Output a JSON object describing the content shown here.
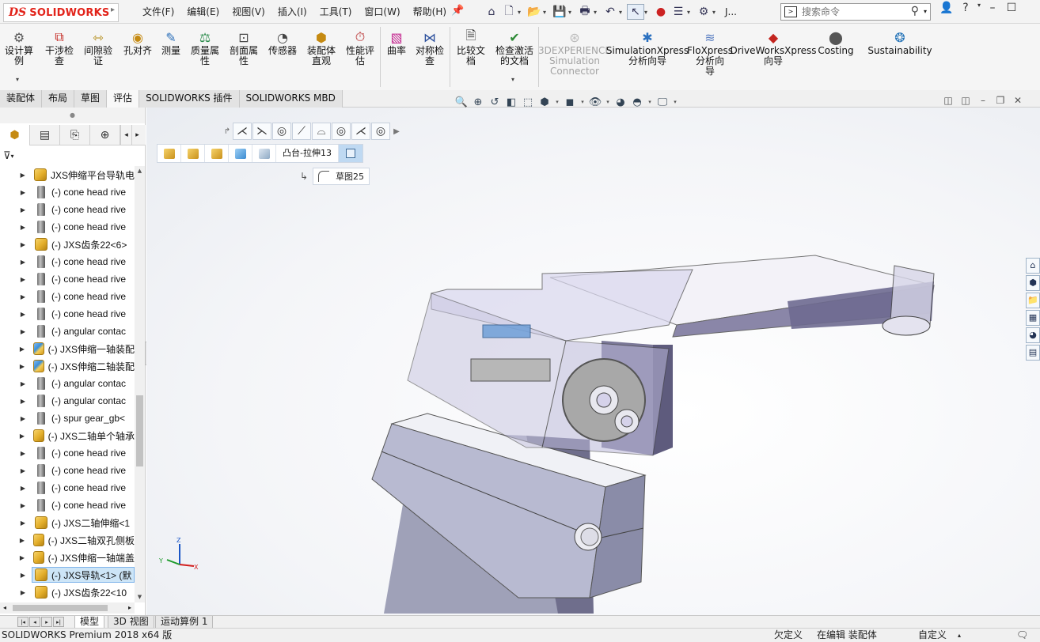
{
  "app": {
    "logo_ds": "DS",
    "logo_name": "SOLIDWORKS"
  },
  "menu": [
    "文件(F)",
    "编辑(E)",
    "视图(V)",
    "插入(I)",
    "工具(T)",
    "窗口(W)",
    "帮助(H)"
  ],
  "quick_access": {
    "user_label": "J..."
  },
  "search": {
    "placeholder": "搜索命令"
  },
  "ribbon": {
    "items": [
      {
        "label": "设计算\n例",
        "icon": "design-study-icon"
      },
      {
        "label": "干涉检\n查",
        "icon": "interference-check-icon"
      },
      {
        "label": "间隙验\n证",
        "icon": "clearance-verification-icon"
      },
      {
        "label": "孔对齐",
        "icon": "hole-alignment-icon"
      },
      {
        "label": "测量",
        "icon": "measure-icon"
      },
      {
        "label": "质量属\n性",
        "icon": "mass-properties-icon"
      },
      {
        "label": "剖面属\n性",
        "icon": "section-properties-icon"
      },
      {
        "label": "传感器",
        "icon": "sensor-icon"
      },
      {
        "label": "装配体\n直观",
        "icon": "assembly-visualization-icon"
      },
      {
        "label": "性能评\n估",
        "icon": "performance-evaluation-icon"
      },
      {
        "label": "曲率",
        "icon": "curvature-icon"
      },
      {
        "label": "对称检\n查",
        "icon": "symmetry-check-icon"
      },
      {
        "label": "比较文\n档",
        "icon": "compare-documents-icon"
      },
      {
        "label": "检查激活\n的文档",
        "icon": "check-active-document-icon"
      },
      {
        "label": "3DEXPERIENCE\nSimulation\nConnector",
        "icon": "3dexperience-icon",
        "disabled": true
      },
      {
        "label": "SimulationXpress\n分析向导",
        "icon": "simulationxpress-icon"
      },
      {
        "label": "FloXpress\n分析向\n导",
        "icon": "floxpress-icon"
      },
      {
        "label": "DriveWorksXpress\n向导",
        "icon": "driveworksxpress-icon"
      },
      {
        "label": "Costing",
        "icon": "costing-icon"
      },
      {
        "label": "Sustainability",
        "icon": "sustainability-icon"
      }
    ]
  },
  "tabs": [
    {
      "label": "装配体",
      "active": false
    },
    {
      "label": "布局",
      "active": false
    },
    {
      "label": "草图",
      "active": false
    },
    {
      "label": "评估",
      "active": true
    },
    {
      "label": "SOLIDWORKS 插件",
      "active": false
    },
    {
      "label": "SOLIDWORKS MBD",
      "active": false
    }
  ],
  "tree": {
    "rows": [
      {
        "text": "JXS伸缩平台导轨电",
        "icon": "assembly"
      },
      {
        "text": "(-) cone head rive",
        "icon": "part"
      },
      {
        "text": "(-) cone head rive",
        "icon": "part"
      },
      {
        "text": "(-) cone head rive",
        "icon": "part"
      },
      {
        "text": "(-) JXS齿条22<6>",
        "icon": "assembly"
      },
      {
        "text": "(-) cone head rive",
        "icon": "part"
      },
      {
        "text": "(-) cone head rive",
        "icon": "part"
      },
      {
        "text": "(-) cone head rive",
        "icon": "part"
      },
      {
        "text": "(-) cone head rive",
        "icon": "part"
      },
      {
        "text": "(-) angular contac",
        "icon": "part"
      },
      {
        "text": "(-) JXS伸缩一轴装配",
        "icon": "assembly-b"
      },
      {
        "text": "(-) JXS伸缩二轴装配",
        "icon": "assembly-b"
      },
      {
        "text": "(-) angular contac",
        "icon": "part"
      },
      {
        "text": "(-) angular contac",
        "icon": "part"
      },
      {
        "text": "(-) spur gear_gb<",
        "icon": "part"
      },
      {
        "text": "(-) JXS二轴单个轴承",
        "icon": "assembly"
      },
      {
        "text": "(-) cone head rive",
        "icon": "part"
      },
      {
        "text": "(-) cone head rive",
        "icon": "part"
      },
      {
        "text": "(-) cone head rive",
        "icon": "part"
      },
      {
        "text": "(-) cone head rive",
        "icon": "part"
      },
      {
        "text": "(-) JXS二轴伸缩<1",
        "icon": "assembly"
      },
      {
        "text": "(-) JXS二轴双孔侧板",
        "icon": "assembly"
      },
      {
        "text": "(-) JXS伸缩一轴端盖",
        "icon": "assembly"
      },
      {
        "text": "(-) JXS导轨<1> (默",
        "icon": "assembly",
        "selected": true
      },
      {
        "text": "(-) JXS齿条22<10",
        "icon": "assembly"
      }
    ]
  },
  "breadcrumb": {
    "feature": "凸台-拉伸13",
    "sketch": "草图25"
  },
  "bottom_tabs": [
    "模型",
    "3D 视图",
    "运动算例 1"
  ],
  "status": {
    "product": "SOLIDWORKS Premium 2018 x64 版",
    "underdefined": "欠定义",
    "editing": "在编辑 装配体",
    "custom": "自定义"
  }
}
